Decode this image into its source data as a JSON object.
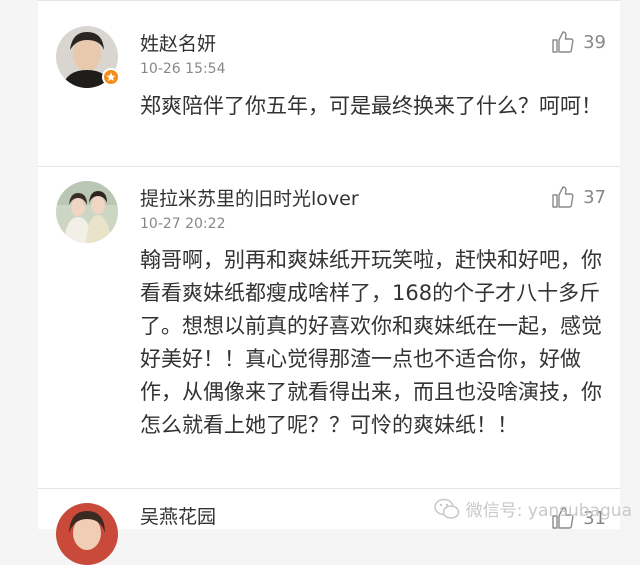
{
  "comments": [
    {
      "username": "姓赵名妍",
      "time": "10-26 15:54",
      "likes": "39",
      "text": "郑爽陪伴了你五年，可是最终换来了什么？呵呵！"
    },
    {
      "username": "提拉米苏里的旧时光lover",
      "time": "10-27 20:22",
      "likes": "37",
      "text": "翰哥啊，别再和爽妹纸开玩笑啦，赶快和好吧，你看看爽妹纸都瘦成啥样了，168的个子才八十多斤了。想想以前真的好喜欢你和爽妹纸在一起，感觉好美好！！真心觉得那渣一点也不适合你，好做作，从偶像来了就看得出来，而且也没啥演技，你怎么就看上她了呢？？可怜的爽妹纸！！"
    },
    {
      "username": "吴燕花园",
      "likes": "31"
    }
  ],
  "watermark": {
    "text": "微信号: yansubagua",
    "icon": "wechat-icon"
  },
  "colors": {
    "badge": "#f48c1b",
    "secondary_text": "#888888"
  }
}
